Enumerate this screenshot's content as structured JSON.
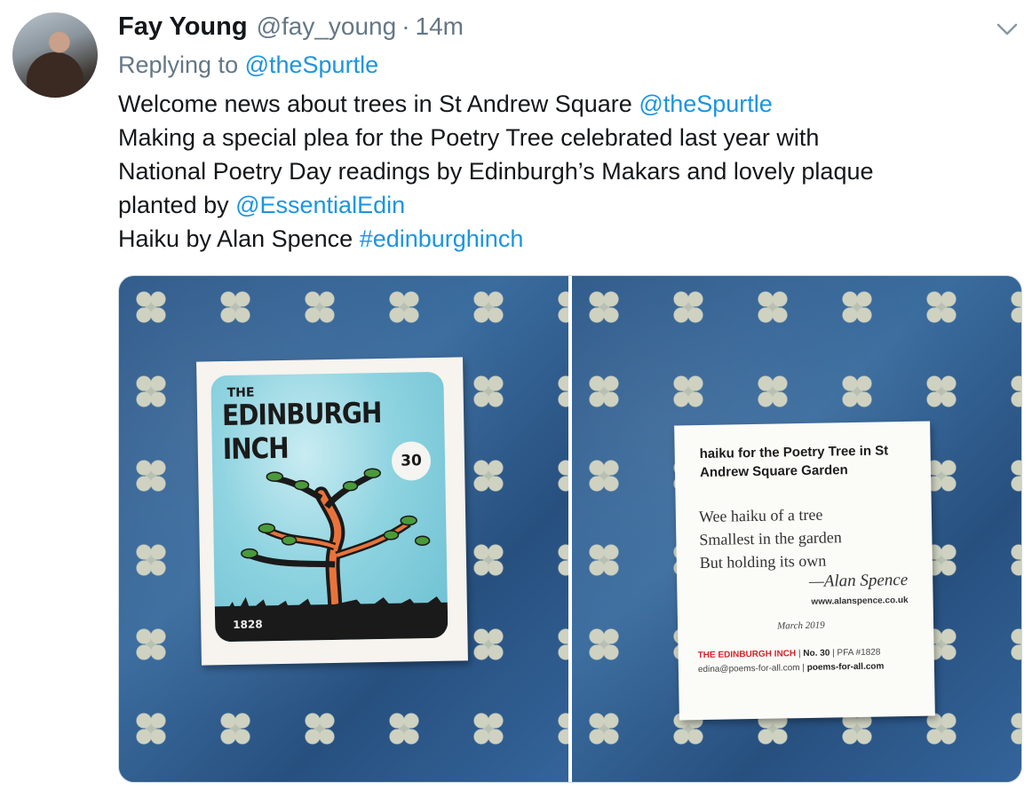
{
  "tweet": {
    "author_name": "Fay Young",
    "handle": "@fay_young",
    "separator": "·",
    "time": "14m",
    "replying_prefix": "Replying to ",
    "replying_to": "@theSpurtle",
    "lines": {
      "l1_text": "Welcome news about trees in St Andrew Square ",
      "l1_mention": "@theSpurtle",
      "l2_text": "Making a special plea for the Poetry Tree celebrated last year with",
      "l3_text": "National Poetry Day readings by Edinburgh’s  Makars and lovely plaque",
      "l4_text": "planted by ",
      "l4_mention": "@EssentialEdin",
      "l5_text": "Haiku by Alan Spence ",
      "l5_hashtag": "#edinburghinch"
    },
    "icons": {
      "menu": "chevron-down-icon",
      "avatar": "user-avatar"
    },
    "colors": {
      "link": "#1b95e0",
      "secondary": "#657786",
      "text": "#14171a"
    }
  },
  "photo_left": {
    "the": "THE",
    "title": "EDINBURGH INCH",
    "number": "30",
    "year": "1828"
  },
  "photo_right": {
    "title": "haiku for the Poetry Tree in St Andrew Square Garden",
    "poem": [
      "Wee haiku of a tree",
      "Smallest in the garden",
      "But holding its own"
    ],
    "author": "—Alan Spence",
    "site": "www.alanspence.co.uk",
    "date": "March 2019",
    "footer_brand": "THE EDINBURGH INCH",
    "footer_sep": " | ",
    "footer_no": "No. 30",
    "footer_pfa": "PFA #1828",
    "footer_email": "edina@poems-for-all.com",
    "footer_web": "poems-for-all.com"
  }
}
